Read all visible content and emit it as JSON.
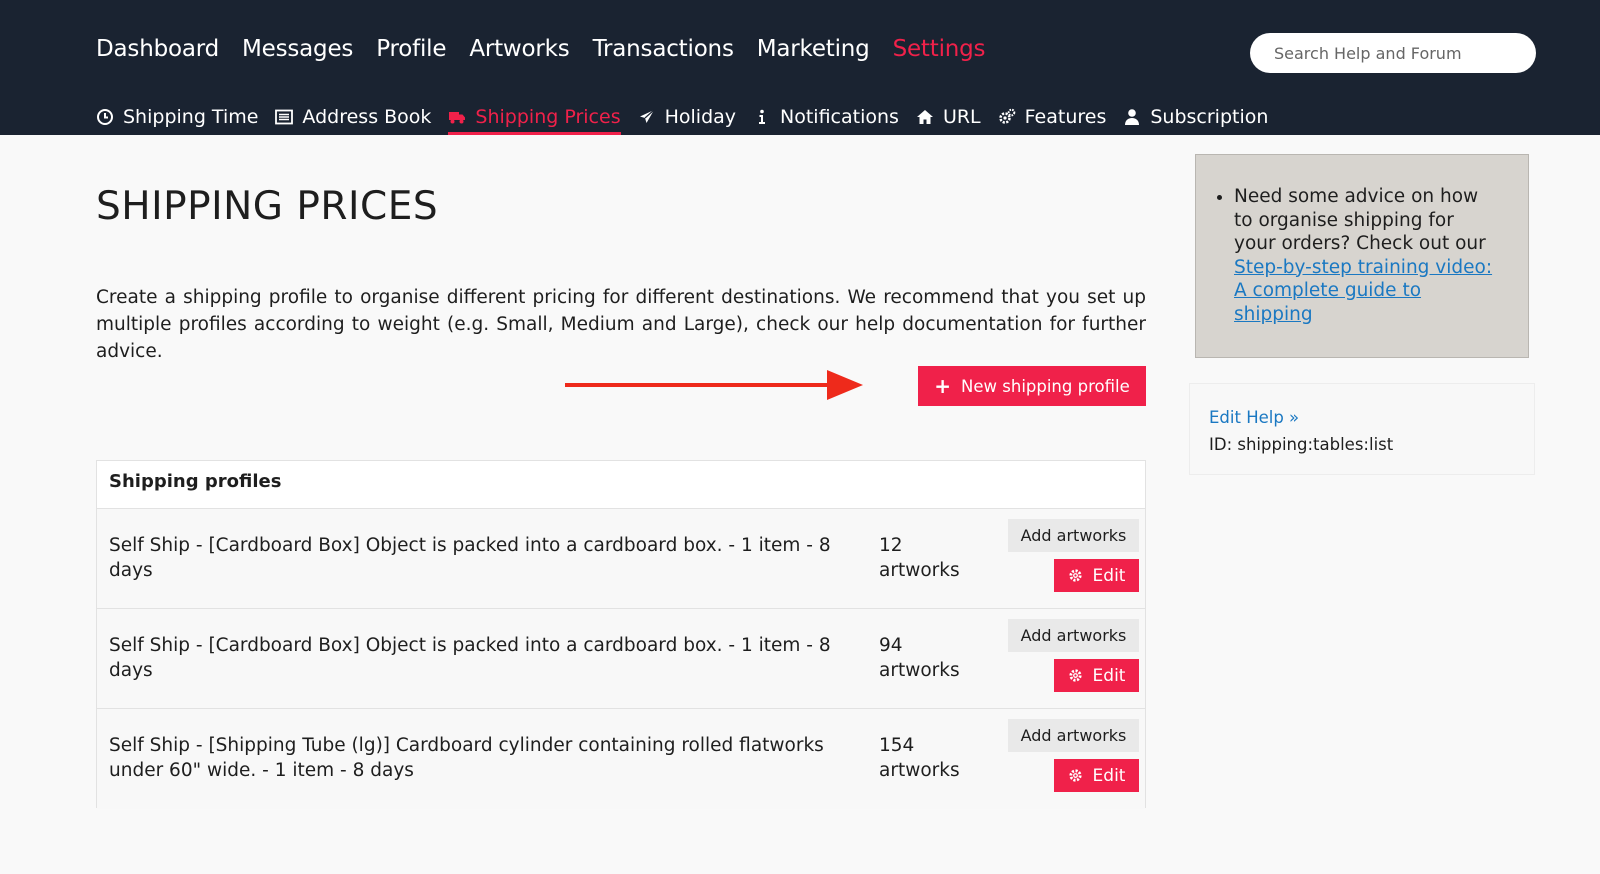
{
  "nav": {
    "main": [
      {
        "label": "Dashboard",
        "active": false
      },
      {
        "label": "Messages",
        "active": false
      },
      {
        "label": "Profile",
        "active": false
      },
      {
        "label": "Artworks",
        "active": false
      },
      {
        "label": "Transactions",
        "active": false
      },
      {
        "label": "Marketing",
        "active": false
      },
      {
        "label": "Settings",
        "active": true
      }
    ],
    "sub": [
      {
        "label": "Shipping Time",
        "icon": "clock-icon"
      },
      {
        "label": "Address Book",
        "icon": "address-book-icon"
      },
      {
        "label": "Shipping Prices",
        "icon": "truck-icon",
        "active": true
      },
      {
        "label": "Holiday",
        "icon": "plane-icon"
      },
      {
        "label": "Notifications",
        "icon": "info-icon"
      },
      {
        "label": "URL",
        "icon": "home-icon"
      },
      {
        "label": "Features",
        "icon": "gears-icon"
      },
      {
        "label": "Subscription",
        "icon": "user-icon"
      }
    ]
  },
  "search": {
    "placeholder": "Search Help and Forum"
  },
  "page": {
    "title": "SHIPPING PRICES",
    "intro": "Create a shipping profile to organise different pricing for different destinations. We recommend that you set up multiple profiles according to weight (e.g. Small, Medium and Large), check our help documentation for further advice.",
    "new_button": "New shipping profile"
  },
  "profiles": {
    "heading": "Shipping profiles",
    "add_label": "Add artworks",
    "edit_label": "Edit",
    "rows": [
      {
        "description": "Self Ship - [Cardboard Box] Object is packed into a cardboard box. - 1 item - 8 days",
        "count": "12",
        "unit": "artworks"
      },
      {
        "description": "Self Ship - [Cardboard Box] Object is packed into a cardboard box. - 1 item - 8 days",
        "count": "94",
        "unit": "artworks"
      },
      {
        "description": "Self Ship - [Shipping Tube (lg)] Cardboard cylinder containing rolled flatworks under 60\" wide. - 1 item - 8 days",
        "count": "154",
        "unit": "artworks"
      }
    ]
  },
  "aside": {
    "tip_text": "Need some advice on how to organise shipping for your orders? Check out our",
    "tip_link": "Step-by-step training video: A complete guide to shipping",
    "edit_help": "Edit Help »",
    "help_id": "ID: shipping:tables:list"
  },
  "colors": {
    "accent": "#f0214a",
    "nav_bg": "#1a2331",
    "link": "#1a78c2",
    "arrow": "#ee2a1b"
  }
}
